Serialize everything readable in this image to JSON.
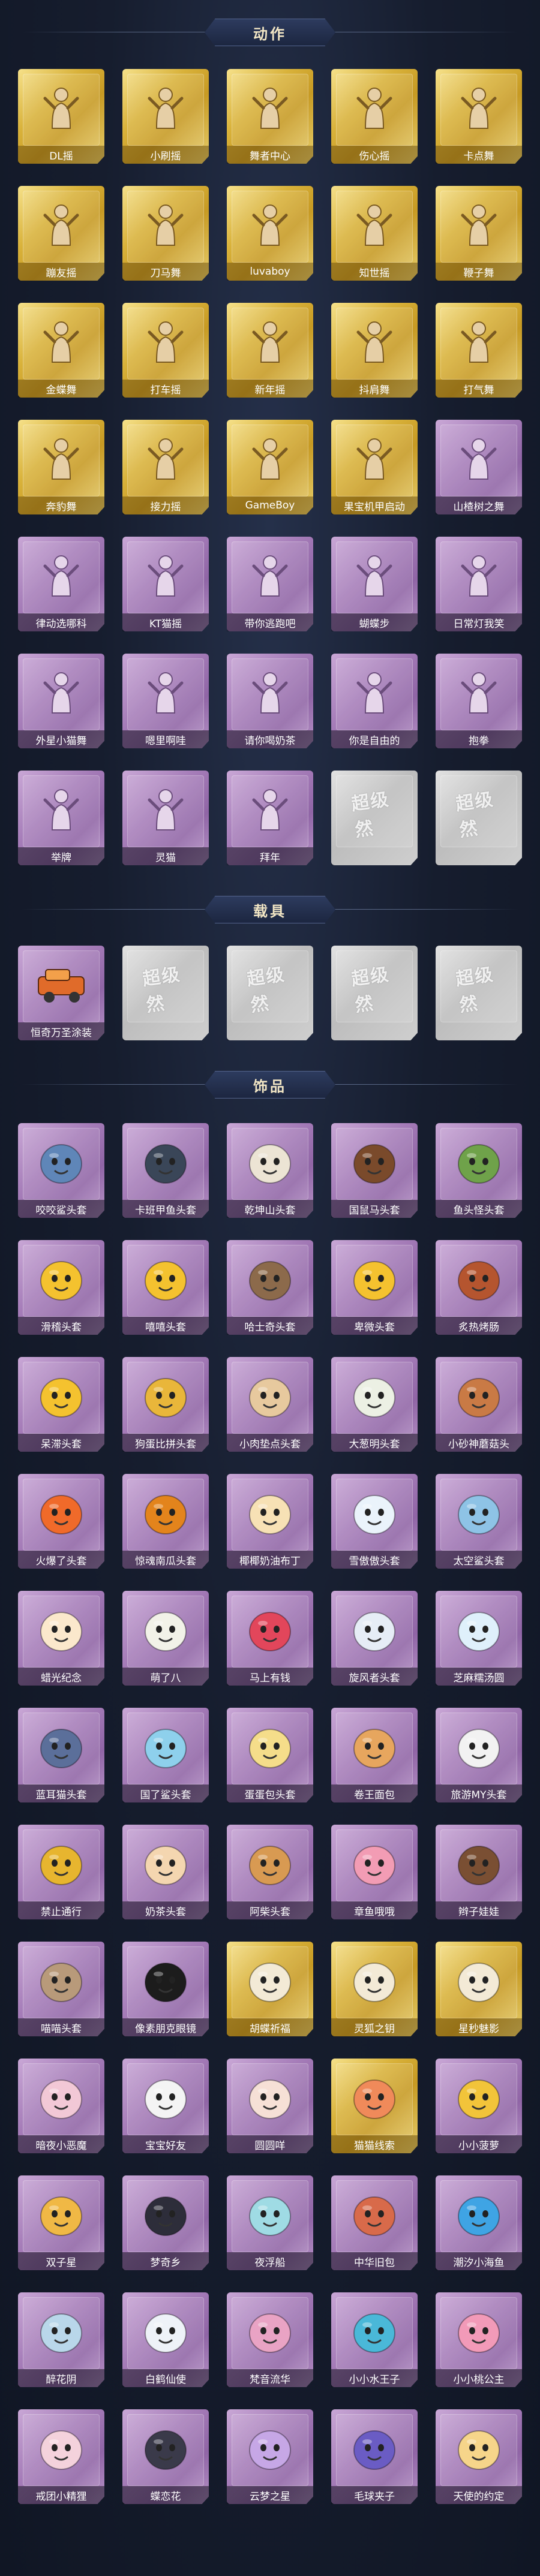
{
  "sections": {
    "actions": {
      "title": "动作",
      "items": [
        {
          "label": "DL摇",
          "tier": "gold",
          "icon": "pose-icon"
        },
        {
          "label": "小刷摇",
          "tier": "gold",
          "icon": "pose-icon"
        },
        {
          "label": "舞者中心",
          "tier": "gold",
          "icon": "pose-icon"
        },
        {
          "label": "伤心摇",
          "tier": "gold",
          "icon": "pose-icon"
        },
        {
          "label": "卡点舞",
          "tier": "gold",
          "icon": "pose-icon"
        },
        {
          "label": "蹦友摇",
          "tier": "gold",
          "icon": "pose-icon"
        },
        {
          "label": "刀马舞",
          "tier": "gold",
          "icon": "pose-icon"
        },
        {
          "label": "luvaboy",
          "tier": "gold",
          "icon": "pose-icon"
        },
        {
          "label": "知世摇",
          "tier": "gold",
          "icon": "pose-icon"
        },
        {
          "label": "鞭子舞",
          "tier": "gold",
          "icon": "pose-icon"
        },
        {
          "label": "金蝶舞",
          "tier": "gold",
          "icon": "pose-icon"
        },
        {
          "label": "打车摇",
          "tier": "gold",
          "icon": "pose-icon"
        },
        {
          "label": "新年摇",
          "tier": "gold",
          "icon": "pose-icon"
        },
        {
          "label": "抖肩舞",
          "tier": "gold",
          "icon": "pose-icon"
        },
        {
          "label": "打气舞",
          "tier": "gold",
          "icon": "pose-icon"
        },
        {
          "label": "奔豹舞",
          "tier": "gold",
          "icon": "pose-icon"
        },
        {
          "label": "接力摇",
          "tier": "gold",
          "icon": "pose-icon"
        },
        {
          "label": "GameBoy",
          "tier": "gold",
          "icon": "pose-icon"
        },
        {
          "label": "果宝机甲启动",
          "tier": "gold",
          "icon": "pose-icon"
        },
        {
          "label": "山楂树之舞",
          "tier": "purple",
          "icon": "pose-icon"
        },
        {
          "label": "律动选哪科",
          "tier": "purple",
          "icon": "pose-icon"
        },
        {
          "label": "KT猫摇",
          "tier": "purple",
          "icon": "pose-icon"
        },
        {
          "label": "带你逃跑吧",
          "tier": "purple",
          "icon": "pose-icon"
        },
        {
          "label": "蝴蝶步",
          "tier": "purple",
          "icon": "pose-icon"
        },
        {
          "label": "日常灯我笑",
          "tier": "purple",
          "icon": "pose-icon"
        },
        {
          "label": "外星小猫舞",
          "tier": "purple",
          "icon": "pose-icon"
        },
        {
          "label": "嗯里啊哇",
          "tier": "purple",
          "icon": "pose-icon"
        },
        {
          "label": "请你喝奶茶",
          "tier": "purple",
          "icon": "pose-icon"
        },
        {
          "label": "你是自由的",
          "tier": "purple",
          "icon": "pose-icon"
        },
        {
          "label": "抱拳",
          "tier": "purple",
          "icon": "pose-icon"
        },
        {
          "label": "举牌",
          "tier": "purple",
          "icon": "pose-icon"
        },
        {
          "label": "灵猫",
          "tier": "purple",
          "icon": "pose-icon"
        },
        {
          "label": "拜年",
          "tier": "purple",
          "icon": "pose-icon"
        },
        {
          "label": "",
          "tier": "grey",
          "icon": "watermark"
        },
        {
          "label": "",
          "tier": "grey",
          "icon": "watermark"
        }
      ]
    },
    "vehicles": {
      "title": "载具",
      "items": [
        {
          "label": "恒奇万圣涂装",
          "tier": "purple",
          "icon": "vehicle-icon"
        },
        {
          "label": "",
          "tier": "grey",
          "icon": "watermark"
        },
        {
          "label": "",
          "tier": "grey",
          "icon": "watermark"
        },
        {
          "label": "",
          "tier": "grey",
          "icon": "watermark"
        },
        {
          "label": "",
          "tier": "grey",
          "icon": "watermark"
        }
      ]
    },
    "accessories": {
      "title": "饰品",
      "items": [
        {
          "label": "咬咬鲨头套",
          "tier": "purple",
          "icon": "head-icon",
          "color": "#5f86b8"
        },
        {
          "label": "卡班甲鱼头套",
          "tier": "purple",
          "icon": "head-icon",
          "color": "#3a4658"
        },
        {
          "label": "乾坤山头套",
          "tier": "purple",
          "icon": "head-icon",
          "color": "#ece4d4"
        },
        {
          "label": "国鼠马头套",
          "tier": "purple",
          "icon": "head-icon",
          "color": "#7a4a2b"
        },
        {
          "label": "鱼头怪头套",
          "tier": "purple",
          "icon": "head-icon",
          "color": "#6fa24a"
        },
        {
          "label": "滑稽头套",
          "tier": "purple",
          "icon": "head-icon",
          "color": "#f4c22f"
        },
        {
          "label": "嘻嘻头套",
          "tier": "purple",
          "icon": "head-icon",
          "color": "#f4c22f"
        },
        {
          "label": "哈士奇头套",
          "tier": "purple",
          "icon": "head-icon",
          "color": "#8c6a4b"
        },
        {
          "label": "卑微头套",
          "tier": "purple",
          "icon": "head-icon",
          "color": "#f4c22f"
        },
        {
          "label": "炙热烤肠",
          "tier": "purple",
          "icon": "head-icon",
          "color": "#b5552f"
        },
        {
          "label": "呆滞头套",
          "tier": "purple",
          "icon": "head-icon",
          "color": "#f4c22f"
        },
        {
          "label": "狗蛋比拼头套",
          "tier": "purple",
          "icon": "head-icon",
          "color": "#e9b63a"
        },
        {
          "label": "小肉垫点头套",
          "tier": "purple",
          "icon": "head-icon",
          "color": "#e7c99e"
        },
        {
          "label": "大葱明头套",
          "tier": "purple",
          "icon": "head-icon",
          "color": "#ecf0e4"
        },
        {
          "label": "小砂神蘑菇头",
          "tier": "purple",
          "icon": "head-icon",
          "color": "#c97a45"
        },
        {
          "label": "火爆了头套",
          "tier": "purple",
          "icon": "head-icon",
          "color": "#f06a2a"
        },
        {
          "label": "惊魂南瓜头套",
          "tier": "purple",
          "icon": "head-icon",
          "color": "#e3841c"
        },
        {
          "label": "椰椰奶油布丁",
          "tier": "purple",
          "icon": "head-icon",
          "color": "#f7e1b5"
        },
        {
          "label": "雪傲傲头套",
          "tier": "purple",
          "icon": "head-icon",
          "color": "#eaf3fb"
        },
        {
          "label": "太空鲨头套",
          "tier": "purple",
          "icon": "head-icon",
          "color": "#8ec3e6"
        },
        {
          "label": "蜡光纪念",
          "tier": "purple",
          "icon": "head-icon",
          "color": "#fbe8cc"
        },
        {
          "label": "萌了八",
          "tier": "purple",
          "icon": "head-icon",
          "color": "#f2f2e8"
        },
        {
          "label": "马上有钱",
          "tier": "purple",
          "icon": "head-icon",
          "color": "#e2465b"
        },
        {
          "label": "旋风者头套",
          "tier": "purple",
          "icon": "head-icon",
          "color": "#e6edf6"
        },
        {
          "label": "芝麻糯汤圆",
          "tier": "purple",
          "icon": "head-icon",
          "color": "#dff0fb"
        },
        {
          "label": "蓝耳猫头套",
          "tier": "purple",
          "icon": "head-icon",
          "color": "#5b6f9a"
        },
        {
          "label": "国了鲨头套",
          "tier": "purple",
          "icon": "head-icon",
          "color": "#8ed0ec"
        },
        {
          "label": "蛋蛋包头套",
          "tier": "purple",
          "icon": "head-icon",
          "color": "#f5dd8a"
        },
        {
          "label": "卷王面包",
          "tier": "purple",
          "icon": "head-icon",
          "color": "#e7a65e"
        },
        {
          "label": "旅游MY头套",
          "tier": "purple",
          "icon": "head-icon",
          "color": "#f2f2f2"
        },
        {
          "label": "禁止通行",
          "tier": "purple",
          "icon": "head-icon",
          "color": "#e7b52f"
        },
        {
          "label": "奶茶头套",
          "tier": "purple",
          "icon": "head-icon",
          "color": "#f4d6b0"
        },
        {
          "label": "阿柴头套",
          "tier": "purple",
          "icon": "head-icon",
          "color": "#d89a52"
        },
        {
          "label": "章鱼哦哦",
          "tier": "purple",
          "icon": "head-icon",
          "color": "#f29cb4"
        },
        {
          "label": "辫子娃娃",
          "tier": "purple",
          "icon": "head-icon",
          "color": "#7a4f33"
        },
        {
          "label": "喵喵头套",
          "tier": "purple",
          "icon": "head-icon",
          "color": "#b89a7a"
        },
        {
          "label": "像素朋克眼镜",
          "tier": "purple",
          "icon": "head-icon",
          "color": "#1c1c1c"
        },
        {
          "label": "胡蝶祈福",
          "tier": "gold",
          "icon": "head-icon",
          "color": "#f3ead6"
        },
        {
          "label": "灵狐之钥",
          "tier": "gold",
          "icon": "head-icon",
          "color": "#f3ead6"
        },
        {
          "label": "星秒魅影",
          "tier": "gold",
          "icon": "head-icon",
          "color": "#f3ead6"
        },
        {
          "label": "暗夜小恶魔",
          "tier": "purple",
          "icon": "head-icon",
          "color": "#f2c8d6"
        },
        {
          "label": "宝宝好友",
          "tier": "purple",
          "icon": "head-icon",
          "color": "#f4f4f4"
        },
        {
          "label": "圆圆咩",
          "tier": "purple",
          "icon": "head-icon",
          "color": "#f6e0d6"
        },
        {
          "label": "猫猫线索",
          "tier": "gold",
          "icon": "head-icon",
          "color": "#f08a5a"
        },
        {
          "label": "小小菠萝",
          "tier": "purple",
          "icon": "head-icon",
          "color": "#f2c43a"
        },
        {
          "label": "双子星",
          "tier": "purple",
          "icon": "head-icon",
          "color": "#f0b845"
        },
        {
          "label": "梦奇乡",
          "tier": "purple",
          "icon": "head-icon",
          "color": "#2d2d3a"
        },
        {
          "label": "夜浮船",
          "tier": "purple",
          "icon": "head-icon",
          "color": "#9fdbe4"
        },
        {
          "label": "中华旧包",
          "tier": "purple",
          "icon": "head-icon",
          "color": "#d86a4a"
        },
        {
          "label": "潮汐小海鱼",
          "tier": "purple",
          "icon": "head-icon",
          "color": "#3fa4e4"
        },
        {
          "label": "醉花阴",
          "tier": "purple",
          "icon": "head-icon",
          "color": "#b9d7ea"
        },
        {
          "label": "白鹤仙使",
          "tier": "purple",
          "icon": "head-icon",
          "color": "#eef2f8"
        },
        {
          "label": "梵音流华",
          "tier": "purple",
          "icon": "head-icon",
          "color": "#e9a3c4"
        },
        {
          "label": "小小水王子",
          "tier": "purple",
          "icon": "head-icon",
          "color": "#4ab8d8"
        },
        {
          "label": "小小桃公主",
          "tier": "purple",
          "icon": "head-icon",
          "color": "#f29ab8"
        },
        {
          "label": "戒团小精狸",
          "tier": "purple",
          "icon": "head-icon",
          "color": "#f4d2dc"
        },
        {
          "label": "蝶恋花",
          "tier": "purple",
          "icon": "head-icon",
          "color": "#3a3a4a"
        },
        {
          "label": "云梦之星",
          "tier": "purple",
          "icon": "head-icon",
          "color": "#c6a7e6"
        },
        {
          "label": "毛球夹子",
          "tier": "purple",
          "icon": "head-icon",
          "color": "#6a5cc4"
        },
        {
          "label": "天使的约定",
          "tier": "purple",
          "icon": "head-icon",
          "color": "#f6d58a"
        }
      ]
    }
  },
  "watermark_text": "超级然",
  "colors": {
    "header_text": "#f2e6c5",
    "gold_card": "#d9b23a",
    "purple_card": "#a67db9",
    "grey_card": "#c9c9c9"
  }
}
